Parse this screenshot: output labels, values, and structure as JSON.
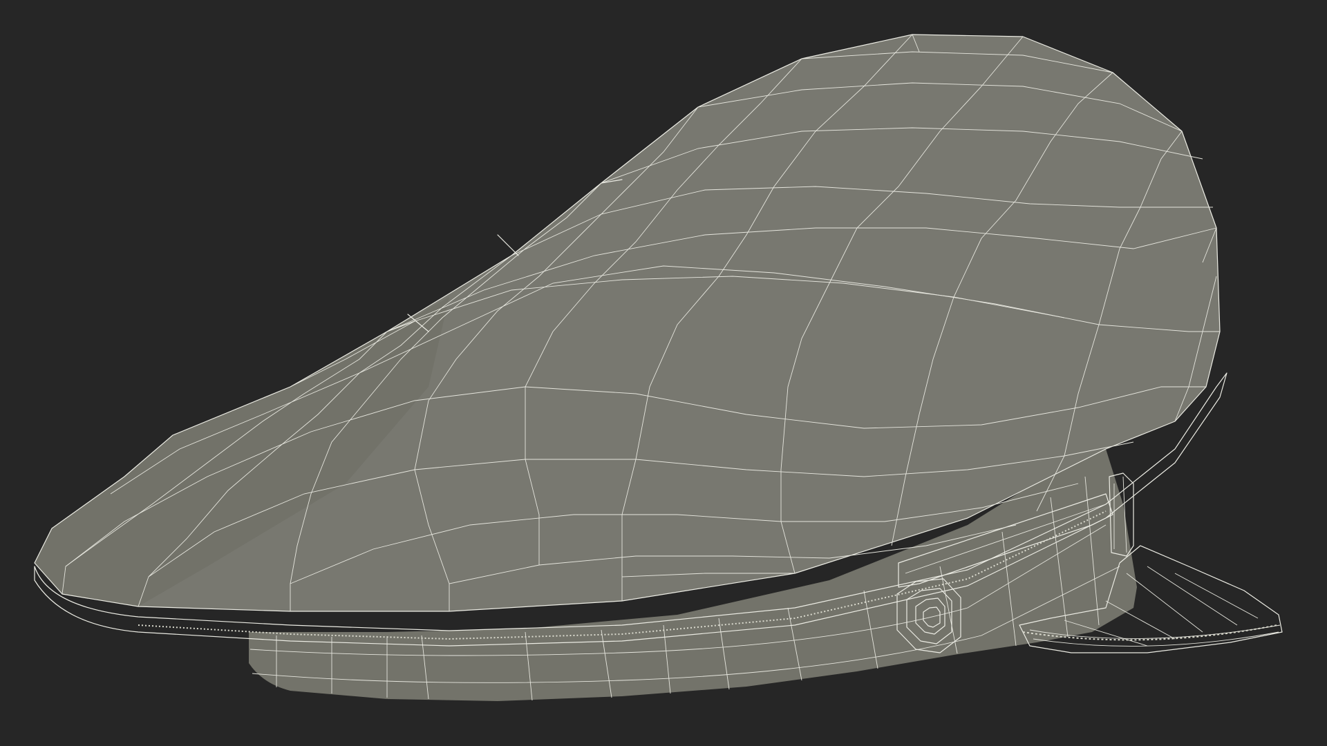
{
  "scene": {
    "subject": "peaked-cap-wireframe-render",
    "colors": {
      "background": "#262626",
      "crown": "#7a7a70",
      "crown_shadow": "#6b6b62",
      "band": "#75756c",
      "band_shadow": "#64645c",
      "wire": "#ecece4",
      "visor": "#7b7b72"
    }
  }
}
